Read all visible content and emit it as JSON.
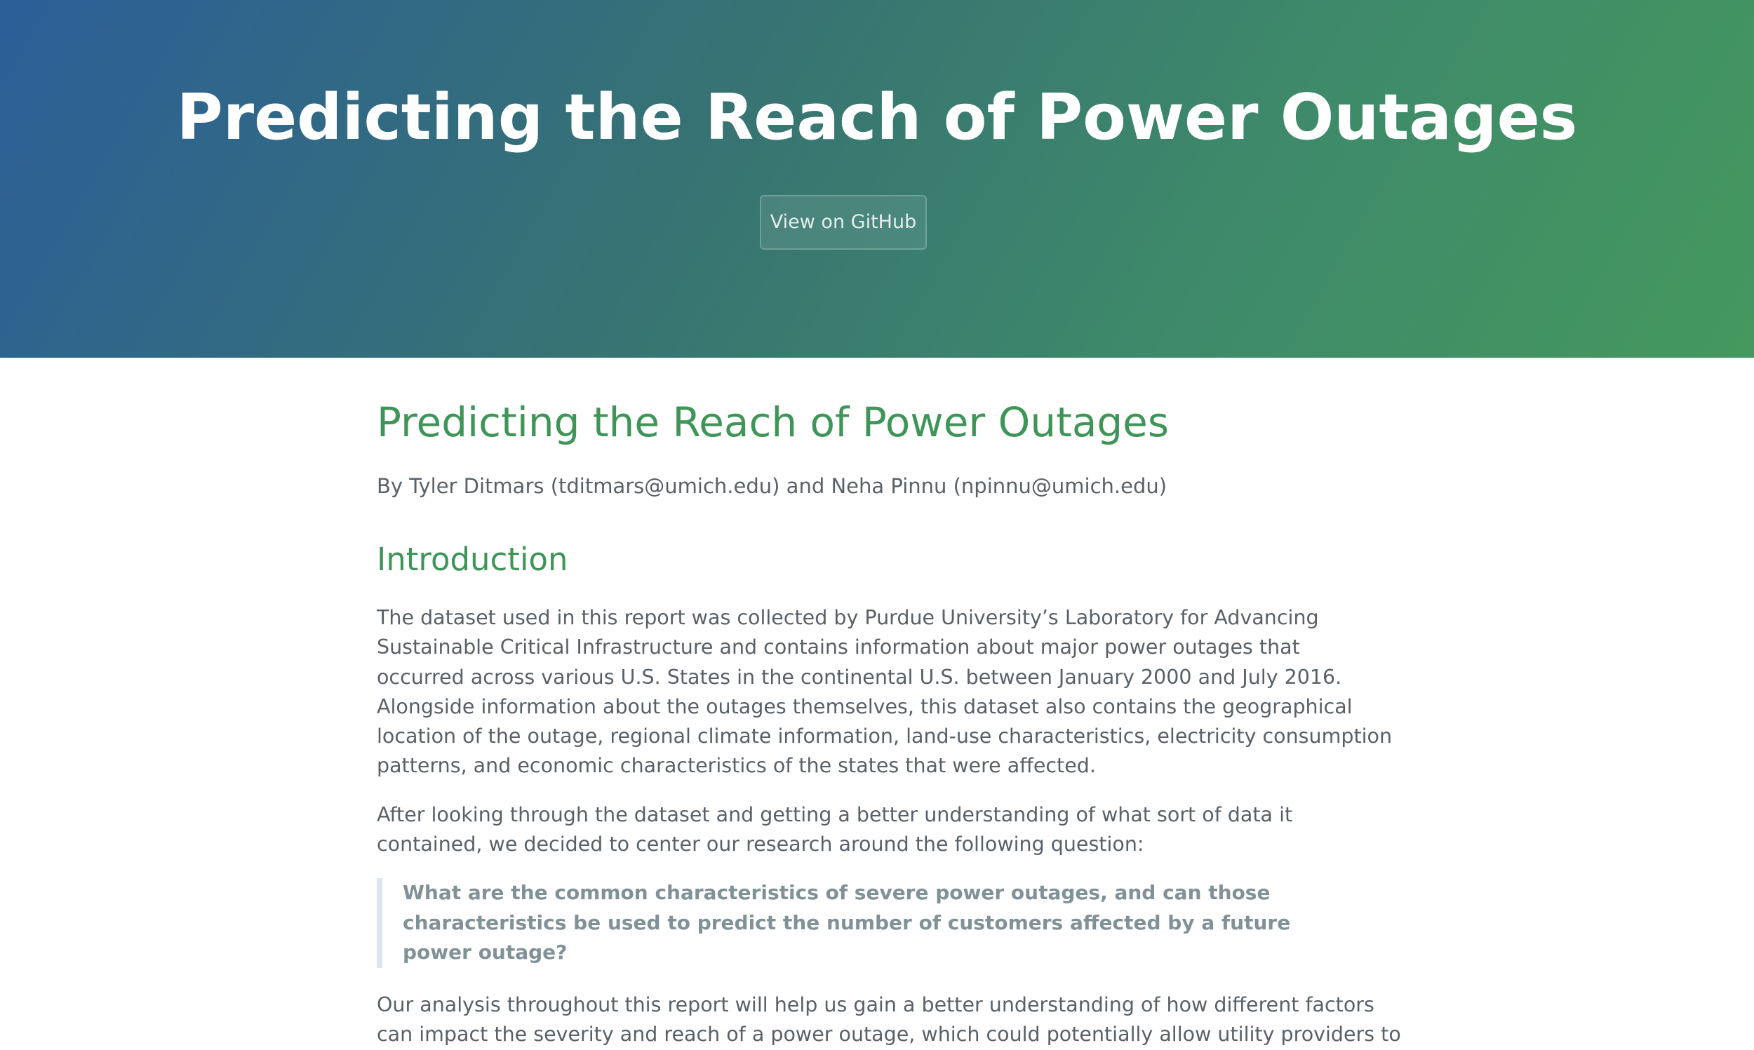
{
  "header": {
    "project_name": "Predicting the Reach of Power Outages",
    "github_button": "View on GitHub"
  },
  "main": {
    "title": "Predicting the Reach of Power Outages",
    "byline": "By Tyler Ditmars (tditmars@umich.edu) and Neha Pinnu (npinnu@umich.edu)",
    "intro_heading": "Introduction",
    "paragraph1": [
      "The dataset used in this report was collected by Purdue University’s Laboratory for Advancing",
      "Sustainable Critical Infrastructure and contains information about major power outages that",
      "occurred across various U.S. States in the continental U.S. between January 2000 and July 2016.",
      "Alongside information about the outages themselves, this dataset also contains the geographical",
      "location of the outage, regional climate information, land-use characteristics, electricity consumption",
      "patterns, and economic characteristics of the states that were affected."
    ],
    "paragraph2": [
      "After looking through the dataset and getting a better understanding of what sort of data it",
      "contained, we decided to center our research around the following question:"
    ],
    "question": [
      "What are the common characteristics of severe power outages, and can those",
      "characteristics be used to predict the number of customers affected by a future",
      "power outage?"
    ],
    "paragraph3": [
      "Our analysis throughout this report will help us gain a better understanding of how different factors",
      "can impact the severity and reach of a power outage, which could potentially allow utility providers to"
    ]
  }
}
